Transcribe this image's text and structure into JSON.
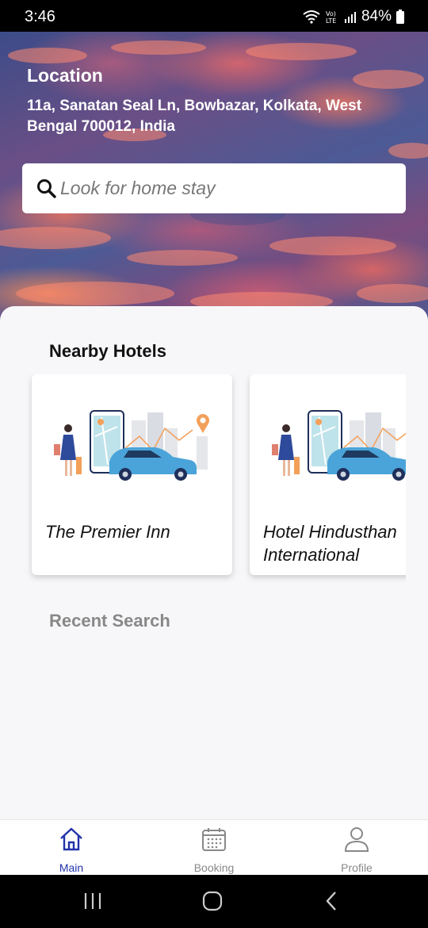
{
  "status_bar": {
    "time": "3:46",
    "battery": "84%",
    "icons": [
      "wifi-icon",
      "volte-icon",
      "signal-icon",
      "battery-icon"
    ]
  },
  "header": {
    "location_title": "Location",
    "address": "11a, Sanatan Seal Ln, Bowbazar, Kolkata, West Bengal 700012, India"
  },
  "search": {
    "placeholder": "Look for home stay",
    "icon": "search-icon"
  },
  "nearby": {
    "title": "Nearby Hotels",
    "hotels": [
      {
        "name": "The Premier Inn"
      },
      {
        "name": "Hotel Hindusthan International"
      }
    ]
  },
  "recent": {
    "title": "Recent Search"
  },
  "bottom_nav": {
    "items": [
      {
        "label": "Main",
        "icon": "home-icon",
        "active": true
      },
      {
        "label": "Booking",
        "icon": "calendar-icon",
        "active": false
      },
      {
        "label": "Profile",
        "icon": "profile-icon",
        "active": false
      }
    ]
  },
  "colors": {
    "accent": "#2233aa",
    "inactive": "#888888",
    "sheet_bg": "#f7f7f9"
  }
}
